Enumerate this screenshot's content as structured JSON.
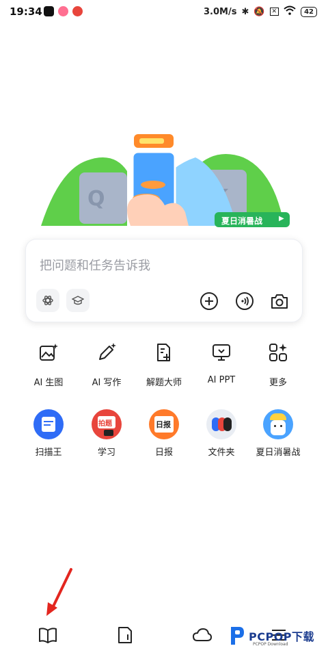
{
  "status_bar": {
    "time": "19:34",
    "network_speed": "3.0M/s",
    "battery": "42"
  },
  "banner": {
    "badge_text": "夏日消暑战",
    "colors": {
      "green": "#5fcf4a",
      "blue": "#4aa3ff",
      "orange": "#ff8a2a"
    }
  },
  "input": {
    "placeholder": "把问题和任务告诉我"
  },
  "tools": [
    {
      "label": "AI 生图",
      "icon": "image-sparkle-icon"
    },
    {
      "label": "AI 写作",
      "icon": "pen-sparkle-icon"
    },
    {
      "label": "解题大师",
      "icon": "document-plus-icon"
    },
    {
      "label": "AI PPT",
      "icon": "presentation-icon"
    },
    {
      "label": "更多",
      "icon": "grid-more-icon"
    }
  ],
  "apps": [
    {
      "label": "扫描王",
      "icon": "scanner-icon",
      "color": "#2f6cf6"
    },
    {
      "label": "学习",
      "icon": "study-icon",
      "color": "#e8453c",
      "badge": "拍题"
    },
    {
      "label": "日报",
      "icon": "daily-icon",
      "color": "#ff7a2a",
      "badge": "日报"
    },
    {
      "label": "文件夹",
      "icon": "folder-icon",
      "color": "#e9edf3"
    },
    {
      "label": "夏日消暑战",
      "icon": "summer-mascot-icon",
      "color": "#4aa3ff"
    }
  ],
  "bottom_nav": [
    {
      "icon": "book-icon"
    },
    {
      "icon": "note-icon"
    },
    {
      "icon": "cloud-icon"
    },
    {
      "icon": "menu-icon"
    }
  ],
  "watermark": {
    "text": "PCPOP下载",
    "sub": "PCPOP Download"
  }
}
